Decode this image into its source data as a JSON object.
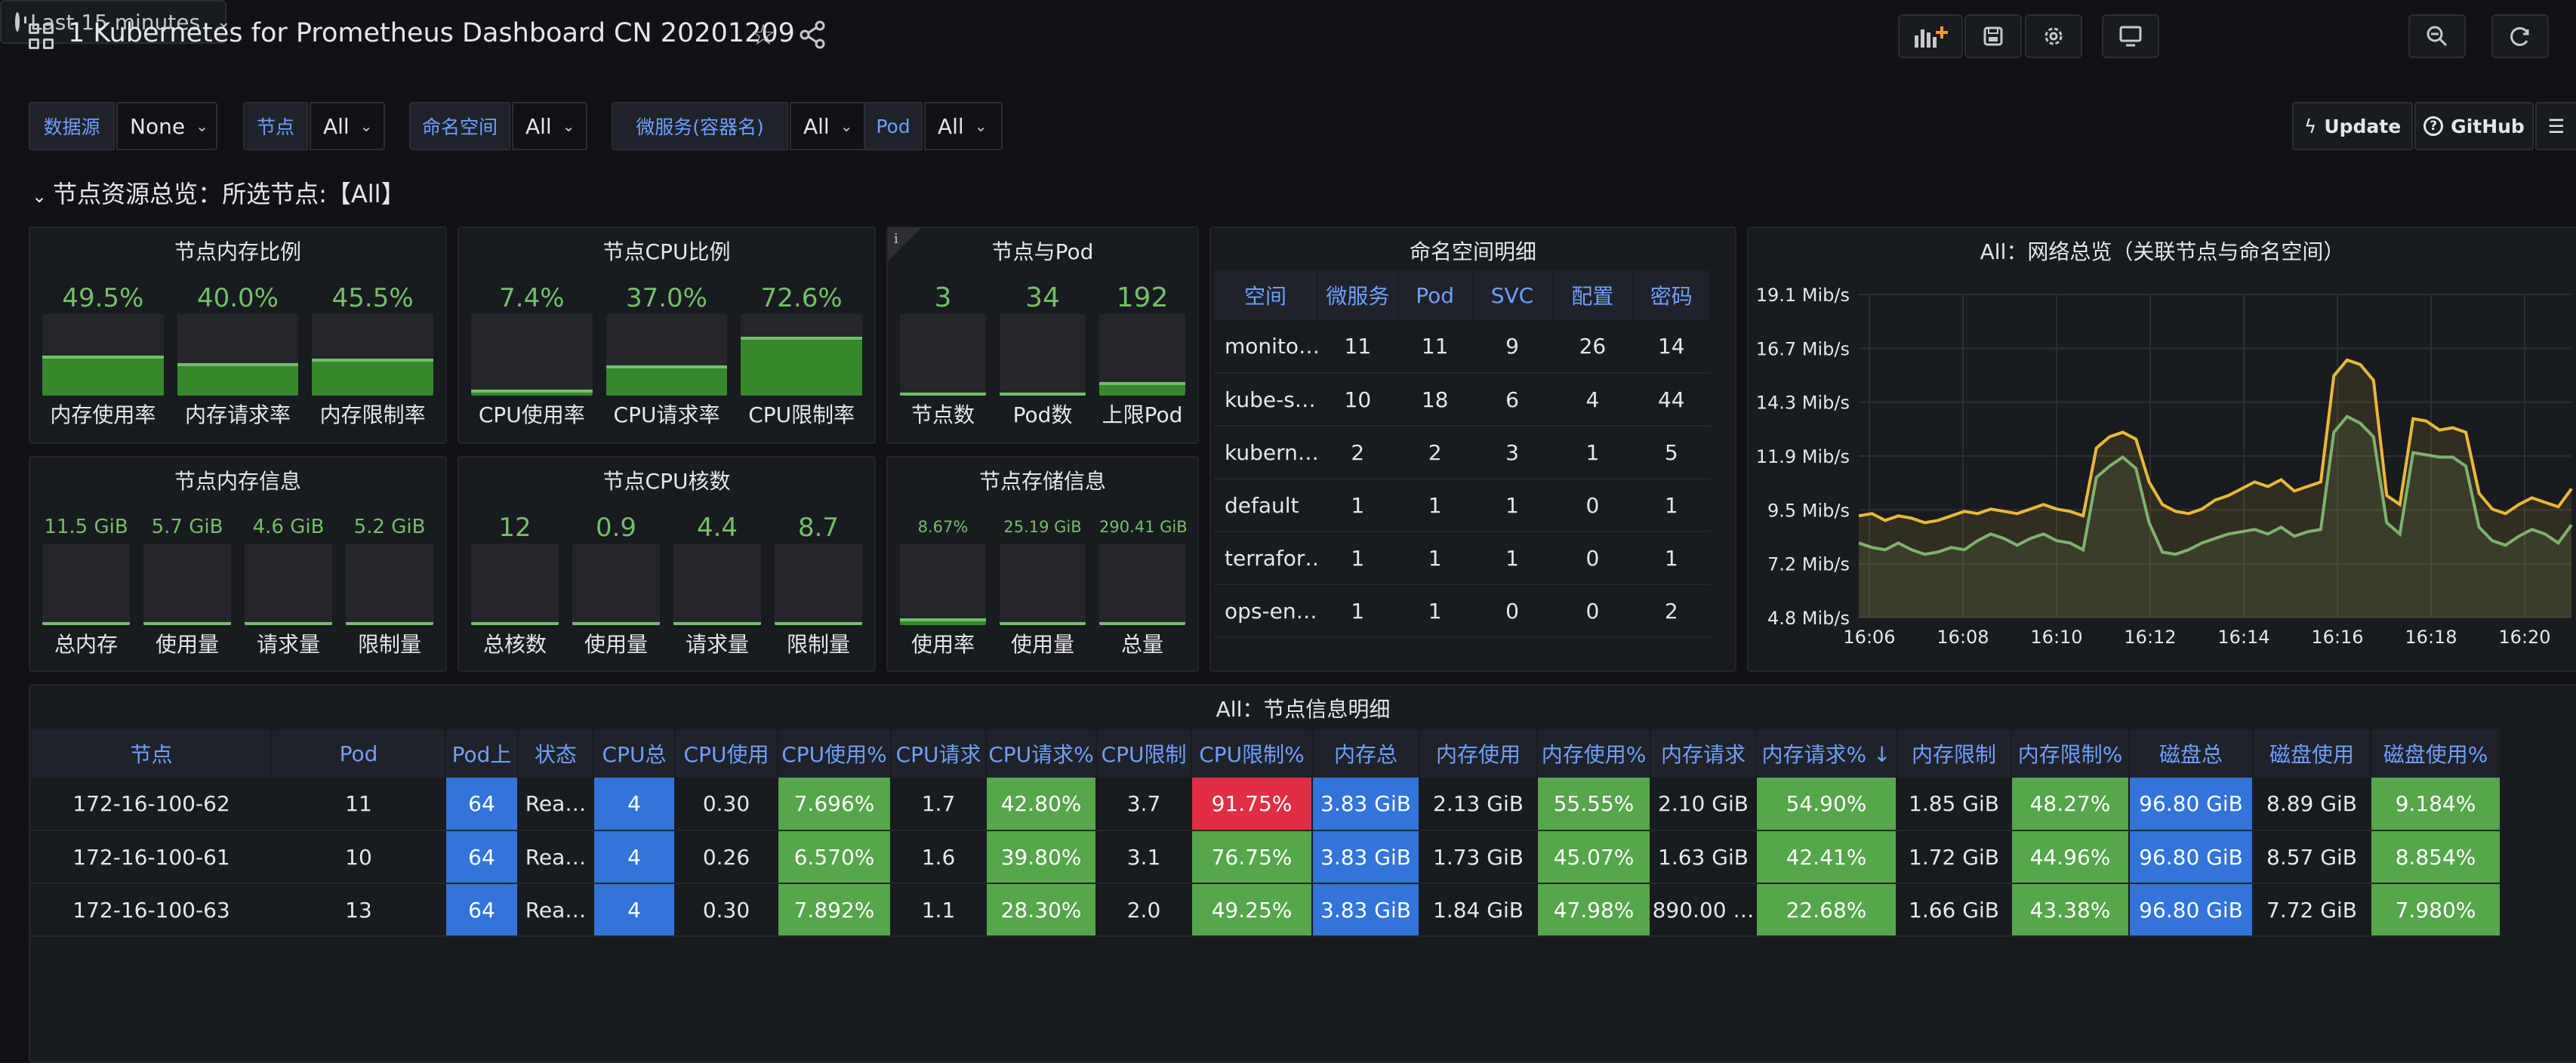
{
  "header": {
    "title": "1 Kubernetes for Prometheus Dashboard CN 20201209",
    "time_range": "Last 15 minutes"
  },
  "variables": [
    {
      "label": "数据源",
      "value": "None"
    },
    {
      "label": "节点",
      "value": "All"
    },
    {
      "label": "命名空间",
      "value": "All"
    },
    {
      "label": "微服务(容器名)",
      "value": "All"
    },
    {
      "label": "Pod",
      "value": "All"
    }
  ],
  "links": {
    "update": "Update",
    "github": "GitHub"
  },
  "row_title": "节点资源总览：所选节点:【All】",
  "panels": {
    "mem_ratio": {
      "title": "节点内存比例",
      "items": [
        {
          "value": "49.5%",
          "label": "内存使用率",
          "fill": 0.495
        },
        {
          "value": "40.0%",
          "label": "内存请求率",
          "fill": 0.4
        },
        {
          "value": "45.5%",
          "label": "内存限制率",
          "fill": 0.455
        }
      ]
    },
    "cpu_ratio": {
      "title": "节点CPU比例",
      "items": [
        {
          "value": "7.4%",
          "label": "CPU使用率",
          "fill": 0.074
        },
        {
          "value": "37.0%",
          "label": "CPU请求率",
          "fill": 0.37
        },
        {
          "value": "72.6%",
          "label": "CPU限制率",
          "fill": 0.726
        }
      ]
    },
    "node_pod": {
      "title": "节点与Pod",
      "items": [
        {
          "value": "3",
          "label": "节点数",
          "fill": 0.03
        },
        {
          "value": "34",
          "label": "Pod数",
          "fill": 0.03
        },
        {
          "value": "192",
          "label": "上限Pod",
          "fill": 0.17
        }
      ]
    },
    "mem_info": {
      "title": "节点内存信息",
      "items": [
        {
          "value": "11.5 GiB",
          "label": "总内存",
          "fill": 0.03
        },
        {
          "value": "5.7 GiB",
          "label": "使用量",
          "fill": 0.03
        },
        {
          "value": "4.6 GiB",
          "label": "请求量",
          "fill": 0.03
        },
        {
          "value": "5.2 GiB",
          "label": "限制量",
          "fill": 0.03
        }
      ]
    },
    "cpu_cores": {
      "title": "节点CPU核数",
      "items": [
        {
          "value": "12",
          "label": "总核数",
          "fill": 0.03
        },
        {
          "value": "0.9",
          "label": "使用量",
          "fill": 0.03
        },
        {
          "value": "4.4",
          "label": "请求量",
          "fill": 0.03
        },
        {
          "value": "8.7",
          "label": "限制量",
          "fill": 0.03
        }
      ]
    },
    "storage": {
      "title": "节点存储信息",
      "items": [
        {
          "value": "8.67%",
          "label": "使用率",
          "fill": 0.087
        },
        {
          "value": "25.19 GiB",
          "label": "使用量",
          "fill": 0.03
        },
        {
          "value": "290.41 GiB",
          "label": "总量",
          "fill": 0.03
        }
      ]
    }
  },
  "namespace_table": {
    "title": "命名空间明细",
    "headers": [
      "空间",
      "微服务",
      "Pod",
      "SVC",
      "配置",
      "密码"
    ],
    "rows": [
      [
        "monito…",
        "11",
        "11",
        "9",
        "26",
        "14"
      ],
      [
        "kube-s…",
        "10",
        "18",
        "6",
        "4",
        "44"
      ],
      [
        "kubern…",
        "2",
        "2",
        "3",
        "1",
        "5"
      ],
      [
        "default",
        "1",
        "1",
        "1",
        "0",
        "1"
      ],
      [
        "terrafor…",
        "1",
        "1",
        "1",
        "0",
        "1"
      ],
      [
        "ops-en…",
        "1",
        "1",
        "0",
        "0",
        "2"
      ]
    ]
  },
  "chart_data": {
    "type": "area",
    "title": "All：网络总览（关联节点与命名空间）",
    "y_ticks": [
      "4.8 Mib/s",
      "7.2 Mib/s",
      "9.5 Mib/s",
      "11.9 Mib/s",
      "14.3 Mib/s",
      "16.7 Mib/s",
      "19.1 Mib/s"
    ],
    "x_ticks": [
      "16:06",
      "16:08",
      "16:10",
      "16:12",
      "16:14",
      "16:16",
      "16:18",
      "16:20"
    ],
    "ylim": [
      4.8,
      19.1
    ],
    "xlim": [
      "16:06",
      "16:21"
    ],
    "colors": [
      "#eab839",
      "#7eb26d"
    ],
    "series": [
      {
        "name": "",
        "values": [
          9.3,
          9.4,
          9.1,
          9.3,
          9.2,
          9.0,
          9.1,
          9.3,
          9.5,
          9.4,
          9.6,
          9.5,
          9.4,
          9.6,
          9.8,
          9.6,
          9.5,
          9.3,
          12.3,
          12.8,
          13.0,
          12.7,
          10.8,
          9.8,
          9.5,
          9.4,
          9.6,
          10.0,
          10.2,
          10.5,
          10.8,
          10.6,
          10.9,
          10.4,
          10.6,
          10.8,
          15.5,
          16.2,
          16.0,
          15.3,
          10.2,
          9.8,
          13.6,
          13.5,
          13.1,
          13.2,
          13.0,
          10.3,
          9.6,
          9.4,
          9.8,
          10.1,
          9.9,
          9.7,
          10.5
        ]
      },
      {
        "name": "",
        "values": [
          8.1,
          7.9,
          7.8,
          8.1,
          7.8,
          7.6,
          7.7,
          7.9,
          7.8,
          8.2,
          8.5,
          8.3,
          8.0,
          8.3,
          8.5,
          8.2,
          8.1,
          7.8,
          11.0,
          11.5,
          11.9,
          11.4,
          9.0,
          7.7,
          7.6,
          7.8,
          8.1,
          8.3,
          8.5,
          8.6,
          8.7,
          8.5,
          8.8,
          8.4,
          8.6,
          8.7,
          13.0,
          13.7,
          13.4,
          12.8,
          9.0,
          8.5,
          12.1,
          12.0,
          11.9,
          11.9,
          11.5,
          8.8,
          8.2,
          8.0,
          8.4,
          8.7,
          8.5,
          8.1,
          8.9
        ]
      }
    ]
  },
  "node_table": {
    "title": "All：节点信息明细",
    "headers": [
      "节点",
      "Pod",
      "Pod上",
      "状态",
      "CPU总",
      "CPU使用",
      "CPU使用%",
      "CPU请求",
      "CPU请求%",
      "CPU限制",
      "CPU限制%",
      "内存总",
      "内存使用",
      "内存使用%",
      "内存请求",
      "内存请求% ↓",
      "内存限制",
      "内存限制%",
      "磁盘总",
      "磁盘使用",
      "磁盘使用%"
    ],
    "rows": [
      [
        "172-16-100-62",
        "11",
        "64",
        "Rea…",
        "4",
        "0.30",
        "7.696%",
        "1.7",
        "42.80%",
        "3.7",
        "91.75%",
        "3.83 GiB",
        "2.13 GiB",
        "55.55%",
        "2.10 GiB",
        "54.90%",
        "1.85 GiB",
        "48.27%",
        "96.80 GiB",
        "8.89 GiB",
        "9.184%"
      ],
      [
        "172-16-100-61",
        "10",
        "64",
        "Rea…",
        "4",
        "0.26",
        "6.570%",
        "1.6",
        "39.80%",
        "3.1",
        "76.75%",
        "3.83 GiB",
        "1.73 GiB",
        "45.07%",
        "1.63 GiB",
        "42.41%",
        "1.72 GiB",
        "44.96%",
        "96.80 GiB",
        "8.57 GiB",
        "8.854%"
      ],
      [
        "172-16-100-63",
        "13",
        "64",
        "Rea…",
        "4",
        "0.30",
        "7.892%",
        "1.1",
        "28.30%",
        "2.0",
        "49.25%",
        "3.83 GiB",
        "1.84 GiB",
        "47.98%",
        "890.00 …",
        "22.68%",
        "1.66 GiB",
        "43.38%",
        "96.80 GiB",
        "7.72 GiB",
        "7.980%"
      ]
    ]
  }
}
